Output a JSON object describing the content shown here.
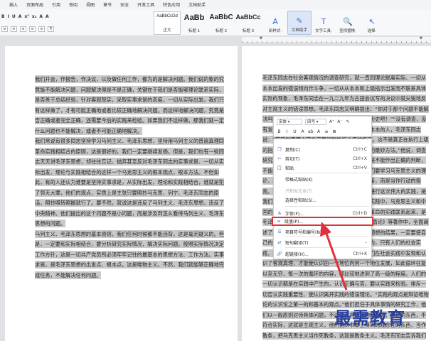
{
  "menu": [
    "插入",
    "页面布局",
    "引用",
    "审阅",
    "视图",
    "章节",
    "安全",
    "开发工具",
    "特色应用",
    "文档助手"
  ],
  "ribbon": {
    "format_row": [
      "B",
      "I",
      "U",
      "A",
      "x²",
      "x₂",
      "A",
      "A"
    ],
    "para_row": [
      "≡",
      "≡",
      "≡",
      "≡",
      "≡",
      "¶"
    ],
    "styles": [
      {
        "preview": "AaBbCcDd",
        "name": "正文"
      },
      {
        "preview": "AaBb",
        "name": "标题 1"
      },
      {
        "preview": "AaBbC",
        "name": "标题 2"
      },
      {
        "preview": "AaBbCc",
        "name": "标题 3"
      }
    ],
    "tools": [
      {
        "icon": "A",
        "label": "新样式·"
      },
      {
        "icon": "✎",
        "label": "文档助手"
      },
      {
        "icon": "T",
        "label": "文字工具·"
      },
      {
        "icon": "🔍",
        "label": "查找替换·"
      },
      {
        "icon": "↖",
        "label": "选择·"
      }
    ]
  },
  "left_page": [
    {
      "indent": true,
      "text": "我们开会，作报告，作决议，以及做任何工作，都为的是解决问题。我们说的象的究竟能不能解决问题，问题解决得是不是正确，关键在于我们是否能够理论联系实际，是否善于总结经验，针对客观现实，采取实事求是的态度，一切从实际出发。我们只有这样做了，才有可能正确地或者比较正确地解决问题。而这样地解决问题，究竟是否正确或者完全正确，还需要今后的实践来检验。如果我们不这样做，那我们就一定什么问题也不能解决，或者不可能正确地解决。"
    },
    {
      "indent": true,
      "text": "我们常说有很多同志坚持学习马列主义、毛泽东思想，坚持用马列主义的普遍真理同革命实践相结合的原则，这是很好的，我们一定要继续发扬。但是，我们也有一些同志天天讲毛泽东思想，却往往忘记、抛弃甚至反对毛泽东同志的实事求是、一切从实际出发、理论与实践相结合的这样一个马克思主义的根本观点，根本方法。不但如此，有的人还认为谁要是坚持实事求是，从实际出发，理论和实践相结合，谁就是犯了弥天大罪，他们的观点，实质上是主张只要照抄马克思、列宁、毛泽东同志的原话，照抄照转照搬就行了。要不然，就说这是违反了马列主义、毛泽东思想，违反了中央精神。他们提出的这个问题不是小问题，而是涉及到怎么看待马列主义、毛泽东思想的问题。"
    },
    {
      "indent": true,
      "text": "马列主义、毛泽东思想的基本原则，我们任何时候都不能违背，这是毫无疑义的。但是，一定要和实际相结合，要分析研究实际情况，解决实际问题。按照实际情况决定工作方针，这是一切共产党员所必须牢牢记住的最基本的思想方法、工作方法。实事求是，是毛泽东思想的出发点、根本点。这是唯物主义。不然，我们就能够正确地完成任务，不能解决任何问题。"
    }
  ],
  "right_page": [
    {
      "indent": false,
      "text": "毛泽东同志在社会客观情况的调查研究，就一直同理论脱离实际、一切从本本出发的错误倾向作斗争，一切从从本本和上级指示出发而不联系具体实际的现象，毛泽东同志在一九二九年为古田会议写的决议中就尖锐地反对主观主义的错误思想。毛泽东同志又明确提出：“你对于那个问题不能解决吗？那末，你就去调查那个问题的现状和它的历史吧！”“没有调查，没有发言权。”对于不通过实践调查研究，只是死背本本的人，毛泽东同志说：“盲目地表面上完全无异议地执行上级的指示，这不是真正在执行上级的指示，这是反对上级指示或者对上级指示怠工的最妙方法。”他说，调查研究，就是为了要把情况了解清楚，不然的话，决不能作出正确的判断，不能提出正确的方针政策。在我们的实践中，我们要学习马克思主义的理论，我们欢迎这个理论，但是并不是把它当作教条，而是当作行动的指南。“实事求是”在战胜了教条主义以后，才能够进行这次伟大的实践，是我们党的思想路线。这是我们在进行这次斗争的实践中，马克思主义和中国的具体实际相结合，把马克思主义理论和中国革命的实践联系起来，是毛泽东思想的精髓。毛泽东同志在《实践论》《矛盾论》等著作中，全面阐述了这个问题，人们要想得到工作的胜利即得到预想的结果，一定要使自己的思想合于客观外界的规律性，毛泽东同志认为，只有人们的社会实践，才是人们对于外界认识的真理性的标准。人们在社会实践中发现和认识了客观真理，才能使认识由一个地位向另一个地位发展，如此循环往复以至无穷，每一次的循环的内容，都比较地进到了高一级的程度。人们的一切认识都是在实践中产生的，认识正确与否，要以实践来检验。排斥一切否认实践重要性、使认识离开实践的错误理论。“实践的观点是辩证唯物论的认识论之第一的和基本的观点。”他们担任于具体事情的研究工作，他们以一般原则对待具体问题，不注意对具体事物的研究。他们的东西，不符合实际，这就是主观主义，他们把从书本上得到的观念性的东西，当作教条，把马克思主义当作死教条，这就是教条主义。毛泽东同志告诉我们要空出现的东西，把它变成为一个人类认识真理的正确标准。"
    }
  ],
  "mini_toolbar": {
    "font": "宋体",
    "size": "四号",
    "buttons_row1": [
      "A⁺",
      "A⁻",
      "✎"
    ],
    "buttons_row2": [
      "B",
      "I",
      "U",
      "A",
      "ab",
      "A",
      "≡",
      "⊞"
    ]
  },
  "context_menu": [
    {
      "icon": "❐",
      "label": "复制(C)",
      "shortcut": "Ctrl+C",
      "disabled": false,
      "highlight": false
    },
    {
      "icon": "✂",
      "label": "剪切(T)",
      "shortcut": "Ctrl+X",
      "disabled": false,
      "highlight": false
    },
    {
      "icon": "📋",
      "label": "粘贴",
      "shortcut": "Ctrl+V",
      "disabled": false,
      "highlight": false
    },
    {
      "icon": "",
      "label": "带格式粘贴(K)",
      "shortcut": "",
      "disabled": false,
      "highlight": false
    },
    {
      "icon": "",
      "label": "只粘贴文本(T)",
      "shortcut": "",
      "disabled": true,
      "highlight": false
    },
    {
      "icon": "",
      "label": "选择性粘贴(S)...",
      "shortcut": "",
      "disabled": false,
      "highlight": false
    },
    {
      "icon": "A",
      "label": "字体(F)...",
      "shortcut": "Ctrl+D",
      "disabled": false,
      "highlight": false
    },
    {
      "icon": "≡",
      "label": "段落(P)...",
      "shortcut": "",
      "disabled": false,
      "highlight": true
    },
    {
      "icon": "☰",
      "label": "项目符号和编号(N)...",
      "shortcut": "",
      "disabled": false,
      "highlight": false
    },
    {
      "icon": "⇄",
      "label": "短句翻译(T)",
      "shortcut": "›",
      "disabled": false,
      "highlight": false
    },
    {
      "icon": "🔗",
      "label": "超链接(H)...",
      "shortcut": "Ctrl+K",
      "disabled": false,
      "highlight": false
    }
  ],
  "watermark": "最需教育",
  "colors": {
    "highlight_border": "#e0303a",
    "selection": "#c9c9c9",
    "watermark": "#2a3f9a"
  }
}
